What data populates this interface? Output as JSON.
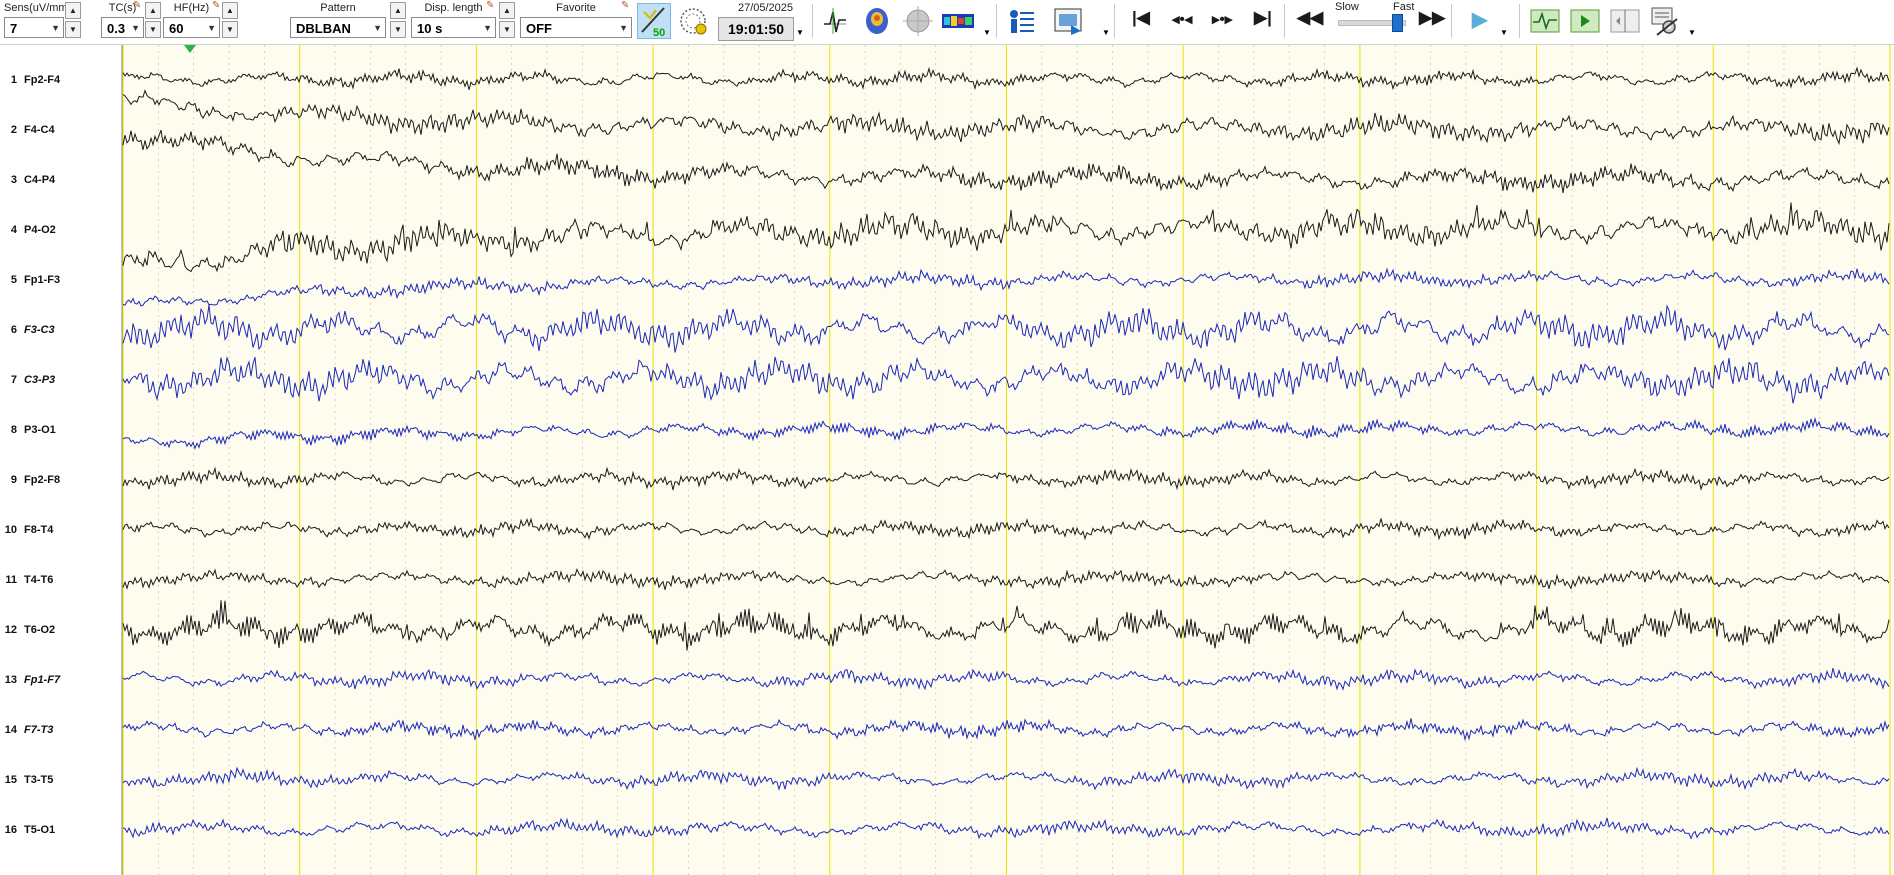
{
  "toolbar": {
    "sens": {
      "label": "Sens(uV/mm)",
      "value": "7"
    },
    "tc": {
      "label": "TC(s)",
      "value": "0.3"
    },
    "hf": {
      "label": "HF(Hz)",
      "value": "60"
    },
    "pattern": {
      "label": "Pattern",
      "value": "DBLBAN"
    },
    "disp_length": {
      "label": "Disp. length",
      "value": "10 s"
    },
    "favorite": {
      "label": "Favorite",
      "value": "OFF"
    },
    "badge_50": "50",
    "date": "27/05/2025",
    "time": "19:01:50",
    "speed": {
      "slow": "Slow",
      "fast": "Fast",
      "level": 0.9
    },
    "icons": [
      "measure-icon",
      "map-icon",
      "sphere-icon",
      "spectrum-icon",
      "patient-info-icon",
      "video-icon",
      "go-start-icon",
      "step-back-icon",
      "step-forward-icon",
      "go-end-icon",
      "rewind-icon",
      "fast-forward-icon",
      "play-icon",
      "signal-icon",
      "marker-play-icon",
      "split-view-icon",
      "settings-icon"
    ]
  },
  "colors": {
    "black_trace": "#1a1a1a",
    "blue_trace": "#1c28b8",
    "grid_major": "#e8e400",
    "grid_minor": "#b8b8a0",
    "background": "#fdfcef",
    "marker": "#2bb34a"
  },
  "channels": [
    {
      "num": "1",
      "name": "Fp2-F4",
      "color": "black",
      "italic": false
    },
    {
      "num": "2",
      "name": "F4-C4",
      "color": "black",
      "italic": false
    },
    {
      "num": "3",
      "name": "C4-P4",
      "color": "black",
      "italic": false
    },
    {
      "num": "4",
      "name": "P4-O2",
      "color": "black",
      "italic": false
    },
    {
      "num": "5",
      "name": "Fp1-F3",
      "color": "blue",
      "italic": false
    },
    {
      "num": "6",
      "name": "F3-C3",
      "color": "blue",
      "italic": true
    },
    {
      "num": "7",
      "name": "C3-P3",
      "color": "blue",
      "italic": true
    },
    {
      "num": "8",
      "name": "P3-O1",
      "color": "blue",
      "italic": false
    },
    {
      "num": "9",
      "name": "Fp2-F8",
      "color": "black",
      "italic": false
    },
    {
      "num": "10",
      "name": "F8-T4",
      "color": "black",
      "italic": false
    },
    {
      "num": "11",
      "name": "T4-T6",
      "color": "black",
      "italic": false
    },
    {
      "num": "12",
      "name": "T6-O2",
      "color": "black",
      "italic": false
    },
    {
      "num": "13",
      "name": "Fp1-F7",
      "color": "blue",
      "italic": true
    },
    {
      "num": "14",
      "name": "F7-T3",
      "color": "blue",
      "italic": true
    },
    {
      "num": "15",
      "name": "T3-T5",
      "color": "blue",
      "italic": false
    },
    {
      "num": "16",
      "name": "T5-O1",
      "color": "blue",
      "italic": false
    }
  ]
}
